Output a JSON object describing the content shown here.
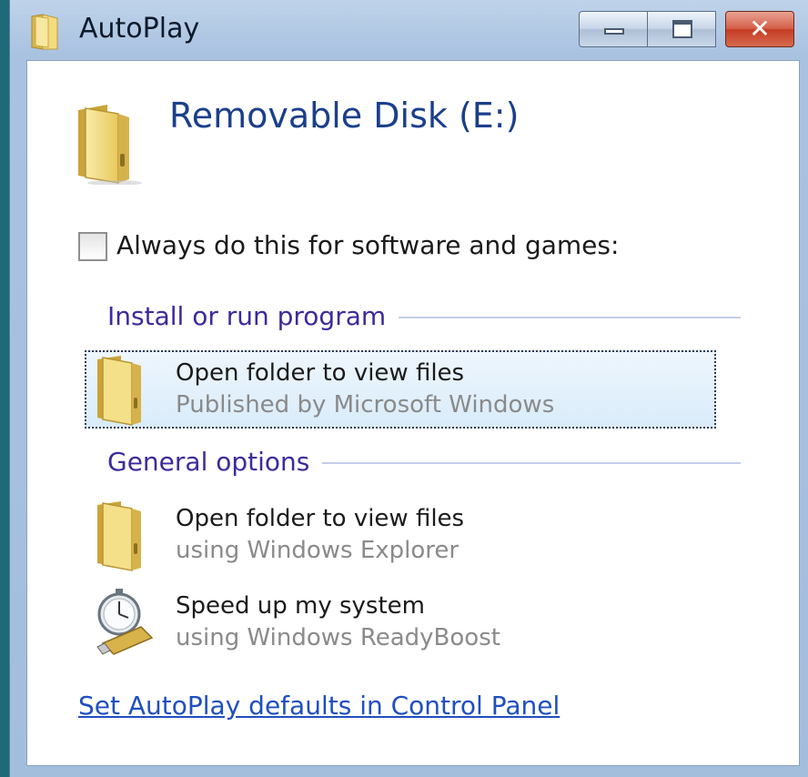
{
  "window": {
    "title": "AutoPlay",
    "title_icon": "folder-icon",
    "controls": {
      "minimize_icon": "minimize-icon",
      "maximize_icon": "maximize-icon",
      "close_icon": "close-icon",
      "close_glyph": "✕"
    }
  },
  "header": {
    "icon": "folder-icon",
    "title": "Removable Disk (E:)"
  },
  "always_option": {
    "label": "Always do this for software and games:",
    "checked": false
  },
  "sections": [
    {
      "title": "Install or run program",
      "options": [
        {
          "icon": "folder-icon",
          "primary": "Open folder to view files",
          "secondary": "Published by Microsoft Windows",
          "selected": true
        }
      ]
    },
    {
      "title": "General options",
      "options": [
        {
          "icon": "folder-icon",
          "primary": "Open folder to view files",
          "secondary": "using Windows Explorer",
          "selected": false
        },
        {
          "icon": "readyboost-stopwatch-usb-icon",
          "primary": "Speed up my system",
          "secondary": "using Windows ReadyBoost",
          "selected": false
        }
      ]
    }
  ],
  "footer": {
    "link": "Set AutoPlay defaults in Control Panel"
  },
  "colors": {
    "heading_blue": "#1b3f8c",
    "section_purple": "#3d2a9c",
    "link_blue": "#1f4fc0",
    "secondary_gray": "#8a8a8a",
    "selection_bg": "#d9ecfa"
  }
}
